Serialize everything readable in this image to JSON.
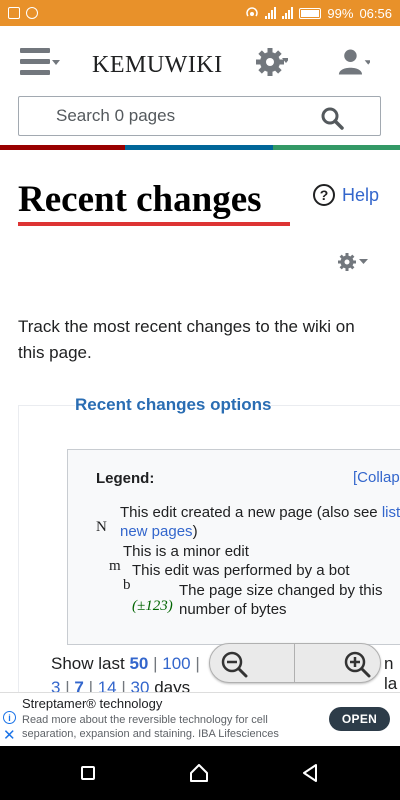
{
  "status_bar": {
    "battery": "99%",
    "time": "06:56"
  },
  "header": {
    "brand": "KEMUWIKI",
    "search_placeholder": "Search 0 pages"
  },
  "stripe_colors": [
    "#990000",
    "#006699",
    "#339966"
  ],
  "page": {
    "title": "Recent changes",
    "help_label": "Help",
    "help_glyph": "?",
    "intro": "Track the most recent changes to the wiki on this page."
  },
  "options": {
    "title": "Recent changes options",
    "legend": {
      "heading": "Legend:",
      "collapse": "[Collapse]",
      "new_page_mark": "N",
      "new_page_text": "This edit created a new page (also see ",
      "new_page_link": "list of new pages",
      "new_page_close": ")",
      "minor_mark": "m",
      "minor_text": "This is a minor edit",
      "bot_mark": "b",
      "bot_text": "This edit was performed by a bot",
      "size_mark": "(±123)",
      "size_text": "The page size changed by this number of bytes"
    },
    "show_last": {
      "prefix": "Show last",
      "opt_50": "50",
      "sep1": "|",
      "opt_100": "100",
      "sep2": "|",
      "trail": "n la"
    },
    "days": {
      "opt_3": "3",
      "sep1": "|",
      "opt_7": "7",
      "sep2": "|",
      "opt_14": "14",
      "sep3": "|",
      "opt_30": "30",
      "suffix": "days"
    }
  },
  "ad": {
    "title": "Streptamer® technology",
    "body": "Read more about the reversible technology for cell separation, expansion and staining. IBA Lifesciences",
    "cta": "OPEN",
    "info_glyph": "i",
    "close_glyph": "✕"
  }
}
